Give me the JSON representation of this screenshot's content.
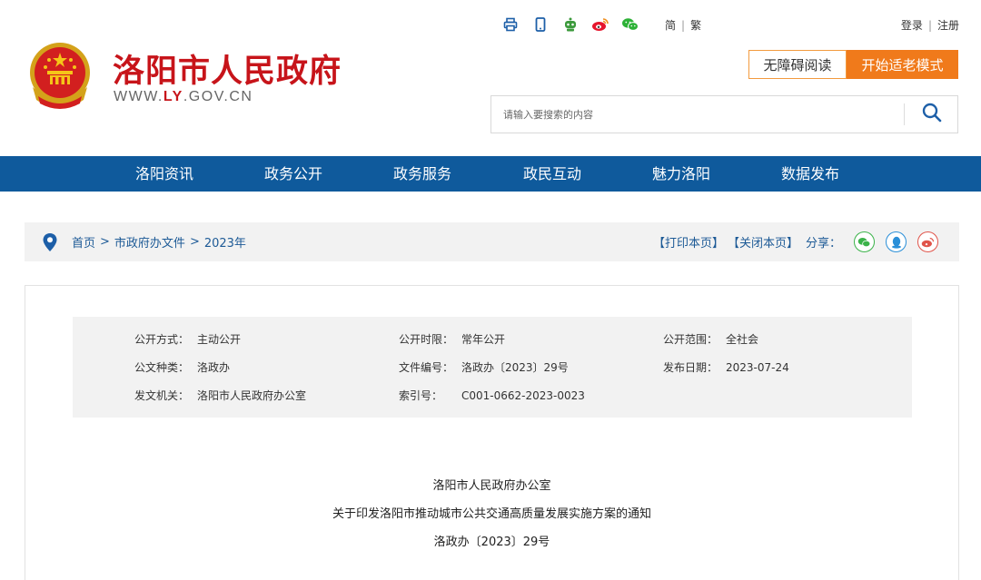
{
  "header": {
    "site_title": "洛阳市人民政府",
    "domain_prefix": "WWW.",
    "domain_highlight": "LY",
    "domain_suffix": ".GOV.CN",
    "top_icons": [
      "print-icon",
      "mobile-icon",
      "robot-icon",
      "weibo-icon",
      "wechat-icon"
    ],
    "lang_simplified": "简",
    "lang_traditional": "繁",
    "login": "登录",
    "register": "注册",
    "accessibility_button": "无障碍阅读",
    "elder_mode_button": "开始适老模式",
    "search_placeholder": "请输入要搜索的内容"
  },
  "nav": {
    "items": [
      "洛阳资讯",
      "政务公开",
      "政务服务",
      "政民互动",
      "魅力洛阳",
      "数据发布"
    ]
  },
  "breadcrumb": {
    "home": "首页",
    "level1": "市政府办文件",
    "level2": "2023年",
    "separator": ">"
  },
  "tools": {
    "print": "【打印本页】",
    "close": "【关闭本页】",
    "share_label": "分享：",
    "share_icons": [
      "wechat-icon",
      "qq-icon",
      "weibo-icon"
    ]
  },
  "meta": {
    "rows": [
      [
        {
          "key": "公开方式：",
          "value": "主动公开"
        },
        {
          "key": "公开时限：",
          "value": "常年公开"
        },
        {
          "key": "公开范围：",
          "value": "全社会"
        }
      ],
      [
        {
          "key": "公文种类：",
          "value": "洛政办"
        },
        {
          "key": "文件编号：",
          "value": "洛政办〔2023〕29号"
        },
        {
          "key": "发布日期：",
          "value": "2023-07-24"
        }
      ],
      [
        {
          "key": "发文机关：",
          "value": "洛阳市人民政府办公室"
        },
        {
          "key": "索引号：",
          "value": "C001-0662-2023-0023"
        }
      ]
    ]
  },
  "document": {
    "issuer": "洛阳市人民政府办公室",
    "title": "关于印发洛阳市推动城市公共交通高质量发展实施方案的通知",
    "doc_number": "洛政办〔2023〕29号"
  },
  "colors": {
    "brand_red": "#c7141a",
    "nav_blue": "#0f5a9c",
    "link_blue": "#1d5a96",
    "orange": "#f07a1b"
  }
}
